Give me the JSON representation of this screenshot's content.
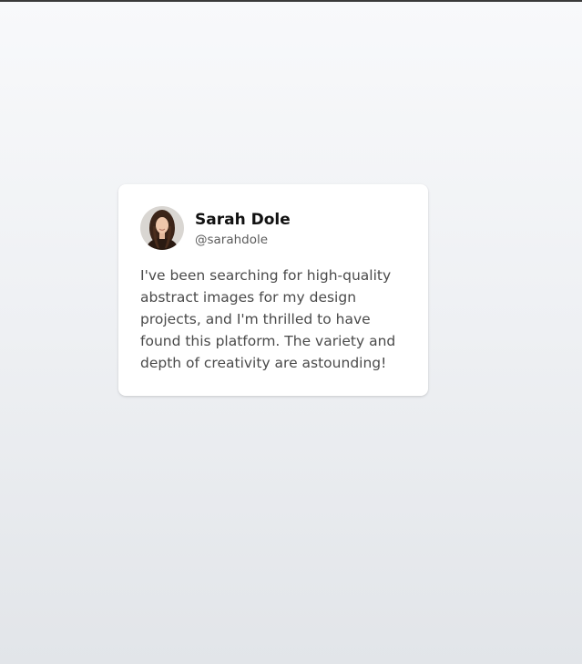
{
  "testimonial": {
    "name": "Sarah Dole",
    "handle": "@sarahdole",
    "quote": "I've been searching for high-quality abstract images for my design projects, and I'm thrilled to have found this platform. The variety and depth of creativity are astounding!"
  },
  "colors": {
    "card_background": "#ffffff",
    "name_text": "#111111",
    "handle_text": "#5b5b5b",
    "quote_text": "#4a4a4a",
    "top_border": "#3a3a3a"
  },
  "icons": {
    "avatar": "user-photo"
  }
}
